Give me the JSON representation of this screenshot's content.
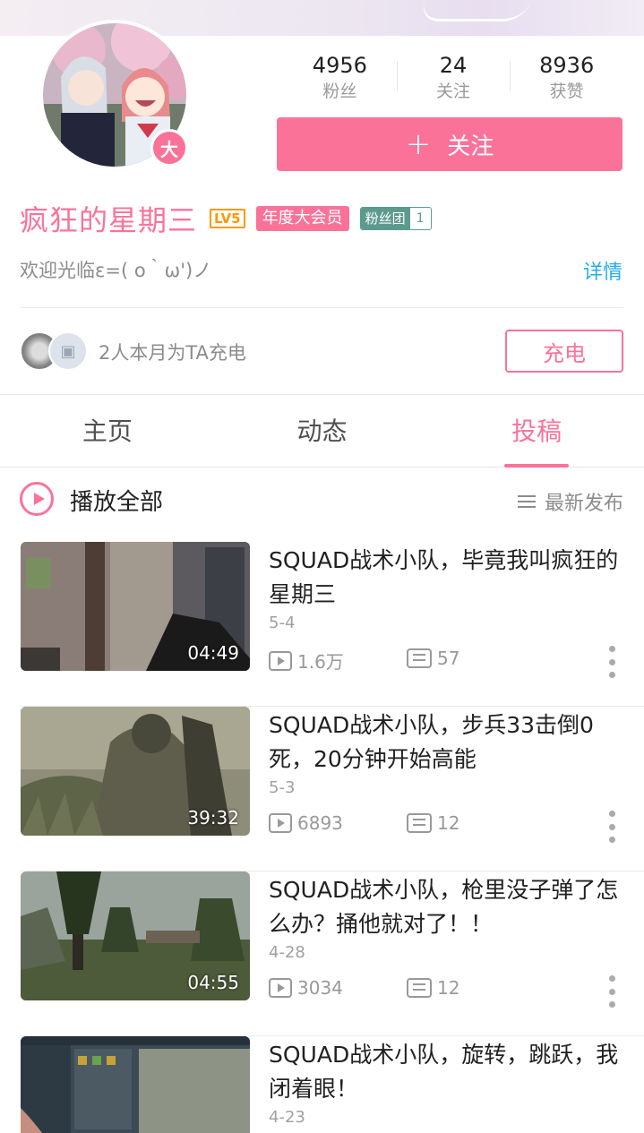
{
  "profile": {
    "vip_badge": "大",
    "stats": [
      {
        "num": "4956",
        "label": "粉丝"
      },
      {
        "num": "24",
        "label": "关注"
      },
      {
        "num": "8936",
        "label": "获赞"
      }
    ],
    "follow_label": "关注",
    "follow_plus": "+",
    "username": "疯狂的星期三",
    "level": "LV5",
    "vip_tag": "年度大会员",
    "fan_tag": "粉丝团",
    "fan_level": "1",
    "sign": "欢迎光临ε=( o｀ω')ノ",
    "detail_label": "详情",
    "charge_text": "2人本月为TA充电",
    "charge_button": "充电"
  },
  "tabs": [
    {
      "label": "主页",
      "active": false
    },
    {
      "label": "动态",
      "active": false
    },
    {
      "label": "投稿",
      "active": true
    }
  ],
  "list_header": {
    "play_all": "播放全部",
    "sort": "最新发布"
  },
  "videos": [
    {
      "title": "SQUAD战术小队，毕竟我叫疯狂的星期三",
      "date": "5-4",
      "duration": "04:49",
      "plays": "1.6万",
      "comments": "57"
    },
    {
      "title": "SQUAD战术小队，步兵33击倒0死，20分钟开始高能",
      "date": "5-3",
      "duration": "39:32",
      "plays": "6893",
      "comments": "12"
    },
    {
      "title": "SQUAD战术小队，枪里没子弹了怎么办？捅他就对了！！",
      "date": "4-28",
      "duration": "04:55",
      "plays": "3034",
      "comments": "12"
    },
    {
      "title": "SQUAD战术小队，旋转，跳跃，我闭着眼！",
      "date": "4-23",
      "duration": "",
      "plays": "",
      "comments": ""
    }
  ],
  "colors": {
    "accent": "#fb7299",
    "link": "#23ade5",
    "level": "#ff9800",
    "fan": "#5d9a8e"
  }
}
